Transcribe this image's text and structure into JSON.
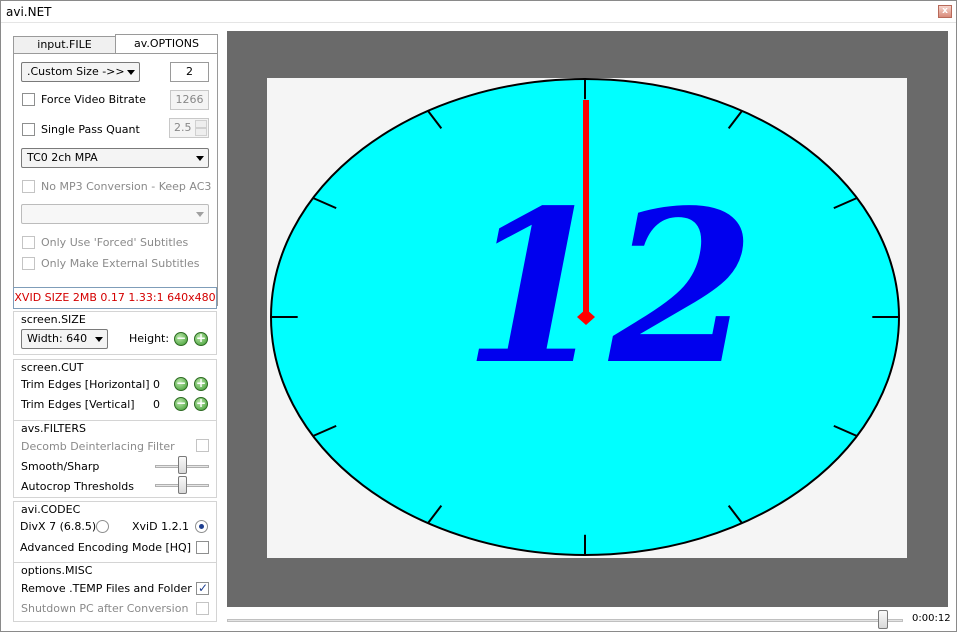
{
  "window": {
    "title": "avi.NET",
    "close_glyph": "x"
  },
  "tabs": [
    {
      "label": "input.FILE"
    },
    {
      "label": "av.OPTIONS"
    }
  ],
  "options": {
    "size_preset": ".Custom Size ->>",
    "size_value": "2",
    "force_video_bitrate_label": "Force Video Bitrate",
    "force_video_bitrate_value": "1266",
    "single_pass_quant_label": "Single Pass Quant",
    "single_pass_quant_value": "2.5",
    "audio_profile": "TC0 2ch MPA",
    "no_mp3_label": "No MP3 Conversion - Keep AC3",
    "subtitle_select": "",
    "only_forced_label": "Only Use 'Forced' Subtitles",
    "only_external_label": "Only Make External Subtitles"
  },
  "status_line": "XVID SIZE 2MB 0.17 1.33:1 640x480",
  "screen_size": {
    "title": "screen.SIZE",
    "width_select": "Width: 640",
    "height_label": "Height:"
  },
  "screen_cut": {
    "title": "screen.CUT",
    "horizontal_label": "Trim Edges [Horizontal]",
    "horizontal_value": "0",
    "vertical_label": "Trim Edges [Vertical]",
    "vertical_value": "0"
  },
  "avs_filters": {
    "title": "avs.FILTERS",
    "decomb_label": "Decomb Deinterlacing Filter",
    "smooth_label": "Smooth/Sharp",
    "autocrop_label": "Autocrop Thresholds",
    "smooth_level": 0.5,
    "autocrop_level": 0.5
  },
  "codec": {
    "title": "avi.CODEC",
    "divx_label": "DivX 7 (6.8.5)",
    "xvid_label": "XviD 1.2.1",
    "selected": "XviD 1.2.1",
    "advanced_label": "Advanced Encoding Mode [HQ]"
  },
  "misc": {
    "title": "options.MISC",
    "remove_temp_label": "Remove .TEMP Files and Folder",
    "shutdown_label": "Shutdown PC after Conversion"
  },
  "preview": {
    "clock_number": "12",
    "clock_face_color": "#00ffff",
    "hand_color": "#ff0000",
    "numeral_color": "#0000ee"
  },
  "playback": {
    "time": "0:00:12",
    "position": 0.97
  },
  "icons": {
    "minus": "minus-icon",
    "plus": "plus-icon",
    "dropdown": "chevron-down-icon",
    "check": "check-icon"
  }
}
